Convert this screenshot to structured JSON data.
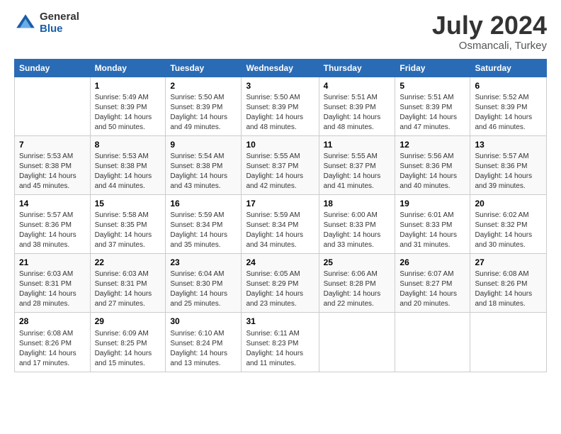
{
  "logo": {
    "general": "General",
    "blue": "Blue"
  },
  "title": {
    "month_year": "July 2024",
    "location": "Osmancali, Turkey"
  },
  "days_of_week": [
    "Sunday",
    "Monday",
    "Tuesday",
    "Wednesday",
    "Thursday",
    "Friday",
    "Saturday"
  ],
  "weeks": [
    [
      {
        "num": "",
        "info": ""
      },
      {
        "num": "1",
        "info": "Sunrise: 5:49 AM\nSunset: 8:39 PM\nDaylight: 14 hours\nand 50 minutes."
      },
      {
        "num": "2",
        "info": "Sunrise: 5:50 AM\nSunset: 8:39 PM\nDaylight: 14 hours\nand 49 minutes."
      },
      {
        "num": "3",
        "info": "Sunrise: 5:50 AM\nSunset: 8:39 PM\nDaylight: 14 hours\nand 48 minutes."
      },
      {
        "num": "4",
        "info": "Sunrise: 5:51 AM\nSunset: 8:39 PM\nDaylight: 14 hours\nand 48 minutes."
      },
      {
        "num": "5",
        "info": "Sunrise: 5:51 AM\nSunset: 8:39 PM\nDaylight: 14 hours\nand 47 minutes."
      },
      {
        "num": "6",
        "info": "Sunrise: 5:52 AM\nSunset: 8:39 PM\nDaylight: 14 hours\nand 46 minutes."
      }
    ],
    [
      {
        "num": "7",
        "info": "Sunrise: 5:53 AM\nSunset: 8:38 PM\nDaylight: 14 hours\nand 45 minutes."
      },
      {
        "num": "8",
        "info": "Sunrise: 5:53 AM\nSunset: 8:38 PM\nDaylight: 14 hours\nand 44 minutes."
      },
      {
        "num": "9",
        "info": "Sunrise: 5:54 AM\nSunset: 8:38 PM\nDaylight: 14 hours\nand 43 minutes."
      },
      {
        "num": "10",
        "info": "Sunrise: 5:55 AM\nSunset: 8:37 PM\nDaylight: 14 hours\nand 42 minutes."
      },
      {
        "num": "11",
        "info": "Sunrise: 5:55 AM\nSunset: 8:37 PM\nDaylight: 14 hours\nand 41 minutes."
      },
      {
        "num": "12",
        "info": "Sunrise: 5:56 AM\nSunset: 8:36 PM\nDaylight: 14 hours\nand 40 minutes."
      },
      {
        "num": "13",
        "info": "Sunrise: 5:57 AM\nSunset: 8:36 PM\nDaylight: 14 hours\nand 39 minutes."
      }
    ],
    [
      {
        "num": "14",
        "info": "Sunrise: 5:57 AM\nSunset: 8:36 PM\nDaylight: 14 hours\nand 38 minutes."
      },
      {
        "num": "15",
        "info": "Sunrise: 5:58 AM\nSunset: 8:35 PM\nDaylight: 14 hours\nand 37 minutes."
      },
      {
        "num": "16",
        "info": "Sunrise: 5:59 AM\nSunset: 8:34 PM\nDaylight: 14 hours\nand 35 minutes."
      },
      {
        "num": "17",
        "info": "Sunrise: 5:59 AM\nSunset: 8:34 PM\nDaylight: 14 hours\nand 34 minutes."
      },
      {
        "num": "18",
        "info": "Sunrise: 6:00 AM\nSunset: 8:33 PM\nDaylight: 14 hours\nand 33 minutes."
      },
      {
        "num": "19",
        "info": "Sunrise: 6:01 AM\nSunset: 8:33 PM\nDaylight: 14 hours\nand 31 minutes."
      },
      {
        "num": "20",
        "info": "Sunrise: 6:02 AM\nSunset: 8:32 PM\nDaylight: 14 hours\nand 30 minutes."
      }
    ],
    [
      {
        "num": "21",
        "info": "Sunrise: 6:03 AM\nSunset: 8:31 PM\nDaylight: 14 hours\nand 28 minutes."
      },
      {
        "num": "22",
        "info": "Sunrise: 6:03 AM\nSunset: 8:31 PM\nDaylight: 14 hours\nand 27 minutes."
      },
      {
        "num": "23",
        "info": "Sunrise: 6:04 AM\nSunset: 8:30 PM\nDaylight: 14 hours\nand 25 minutes."
      },
      {
        "num": "24",
        "info": "Sunrise: 6:05 AM\nSunset: 8:29 PM\nDaylight: 14 hours\nand 23 minutes."
      },
      {
        "num": "25",
        "info": "Sunrise: 6:06 AM\nSunset: 8:28 PM\nDaylight: 14 hours\nand 22 minutes."
      },
      {
        "num": "26",
        "info": "Sunrise: 6:07 AM\nSunset: 8:27 PM\nDaylight: 14 hours\nand 20 minutes."
      },
      {
        "num": "27",
        "info": "Sunrise: 6:08 AM\nSunset: 8:26 PM\nDaylight: 14 hours\nand 18 minutes."
      }
    ],
    [
      {
        "num": "28",
        "info": "Sunrise: 6:08 AM\nSunset: 8:26 PM\nDaylight: 14 hours\nand 17 minutes."
      },
      {
        "num": "29",
        "info": "Sunrise: 6:09 AM\nSunset: 8:25 PM\nDaylight: 14 hours\nand 15 minutes."
      },
      {
        "num": "30",
        "info": "Sunrise: 6:10 AM\nSunset: 8:24 PM\nDaylight: 14 hours\nand 13 minutes."
      },
      {
        "num": "31",
        "info": "Sunrise: 6:11 AM\nSunset: 8:23 PM\nDaylight: 14 hours\nand 11 minutes."
      },
      {
        "num": "",
        "info": ""
      },
      {
        "num": "",
        "info": ""
      },
      {
        "num": "",
        "info": ""
      }
    ]
  ]
}
